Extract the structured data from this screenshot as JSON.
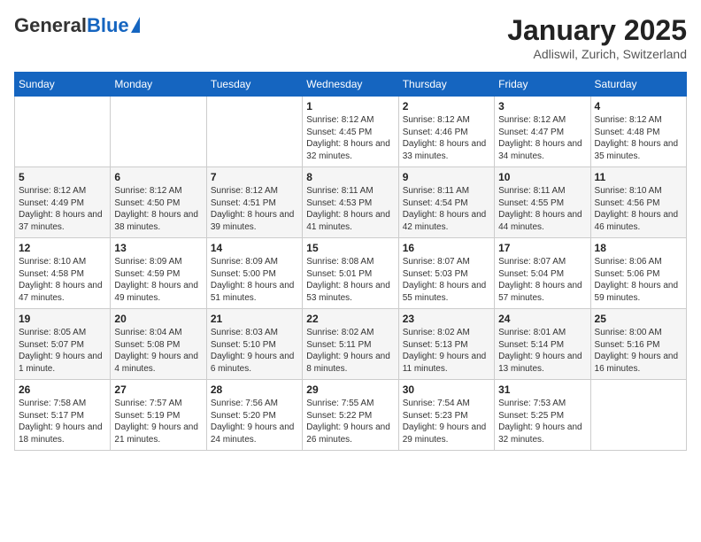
{
  "header": {
    "logo_general": "General",
    "logo_blue": "Blue",
    "month_year": "January 2025",
    "location": "Adliswil, Zurich, Switzerland"
  },
  "weekdays": [
    "Sunday",
    "Monday",
    "Tuesday",
    "Wednesday",
    "Thursday",
    "Friday",
    "Saturday"
  ],
  "weeks": [
    [
      null,
      null,
      null,
      {
        "day": 1,
        "sunrise": "8:12 AM",
        "sunset": "4:45 PM",
        "daylight": "8 hours and 32 minutes."
      },
      {
        "day": 2,
        "sunrise": "8:12 AM",
        "sunset": "4:46 PM",
        "daylight": "8 hours and 33 minutes."
      },
      {
        "day": 3,
        "sunrise": "8:12 AM",
        "sunset": "4:47 PM",
        "daylight": "8 hours and 34 minutes."
      },
      {
        "day": 4,
        "sunrise": "8:12 AM",
        "sunset": "4:48 PM",
        "daylight": "8 hours and 35 minutes."
      }
    ],
    [
      {
        "day": 5,
        "sunrise": "8:12 AM",
        "sunset": "4:49 PM",
        "daylight": "8 hours and 37 minutes."
      },
      {
        "day": 6,
        "sunrise": "8:12 AM",
        "sunset": "4:50 PM",
        "daylight": "8 hours and 38 minutes."
      },
      {
        "day": 7,
        "sunrise": "8:12 AM",
        "sunset": "4:51 PM",
        "daylight": "8 hours and 39 minutes."
      },
      {
        "day": 8,
        "sunrise": "8:11 AM",
        "sunset": "4:53 PM",
        "daylight": "8 hours and 41 minutes."
      },
      {
        "day": 9,
        "sunrise": "8:11 AM",
        "sunset": "4:54 PM",
        "daylight": "8 hours and 42 minutes."
      },
      {
        "day": 10,
        "sunrise": "8:11 AM",
        "sunset": "4:55 PM",
        "daylight": "8 hours and 44 minutes."
      },
      {
        "day": 11,
        "sunrise": "8:10 AM",
        "sunset": "4:56 PM",
        "daylight": "8 hours and 46 minutes."
      }
    ],
    [
      {
        "day": 12,
        "sunrise": "8:10 AM",
        "sunset": "4:58 PM",
        "daylight": "8 hours and 47 minutes."
      },
      {
        "day": 13,
        "sunrise": "8:09 AM",
        "sunset": "4:59 PM",
        "daylight": "8 hours and 49 minutes."
      },
      {
        "day": 14,
        "sunrise": "8:09 AM",
        "sunset": "5:00 PM",
        "daylight": "8 hours and 51 minutes."
      },
      {
        "day": 15,
        "sunrise": "8:08 AM",
        "sunset": "5:01 PM",
        "daylight": "8 hours and 53 minutes."
      },
      {
        "day": 16,
        "sunrise": "8:07 AM",
        "sunset": "5:03 PM",
        "daylight": "8 hours and 55 minutes."
      },
      {
        "day": 17,
        "sunrise": "8:07 AM",
        "sunset": "5:04 PM",
        "daylight": "8 hours and 57 minutes."
      },
      {
        "day": 18,
        "sunrise": "8:06 AM",
        "sunset": "5:06 PM",
        "daylight": "8 hours and 59 minutes."
      }
    ],
    [
      {
        "day": 19,
        "sunrise": "8:05 AM",
        "sunset": "5:07 PM",
        "daylight": "9 hours and 1 minute."
      },
      {
        "day": 20,
        "sunrise": "8:04 AM",
        "sunset": "5:08 PM",
        "daylight": "9 hours and 4 minutes."
      },
      {
        "day": 21,
        "sunrise": "8:03 AM",
        "sunset": "5:10 PM",
        "daylight": "9 hours and 6 minutes."
      },
      {
        "day": 22,
        "sunrise": "8:02 AM",
        "sunset": "5:11 PM",
        "daylight": "9 hours and 8 minutes."
      },
      {
        "day": 23,
        "sunrise": "8:02 AM",
        "sunset": "5:13 PM",
        "daylight": "9 hours and 11 minutes."
      },
      {
        "day": 24,
        "sunrise": "8:01 AM",
        "sunset": "5:14 PM",
        "daylight": "9 hours and 13 minutes."
      },
      {
        "day": 25,
        "sunrise": "8:00 AM",
        "sunset": "5:16 PM",
        "daylight": "9 hours and 16 minutes."
      }
    ],
    [
      {
        "day": 26,
        "sunrise": "7:58 AM",
        "sunset": "5:17 PM",
        "daylight": "9 hours and 18 minutes."
      },
      {
        "day": 27,
        "sunrise": "7:57 AM",
        "sunset": "5:19 PM",
        "daylight": "9 hours and 21 minutes."
      },
      {
        "day": 28,
        "sunrise": "7:56 AM",
        "sunset": "5:20 PM",
        "daylight": "9 hours and 24 minutes."
      },
      {
        "day": 29,
        "sunrise": "7:55 AM",
        "sunset": "5:22 PM",
        "daylight": "9 hours and 26 minutes."
      },
      {
        "day": 30,
        "sunrise": "7:54 AM",
        "sunset": "5:23 PM",
        "daylight": "9 hours and 29 minutes."
      },
      {
        "day": 31,
        "sunrise": "7:53 AM",
        "sunset": "5:25 PM",
        "daylight": "9 hours and 32 minutes."
      },
      null
    ]
  ]
}
